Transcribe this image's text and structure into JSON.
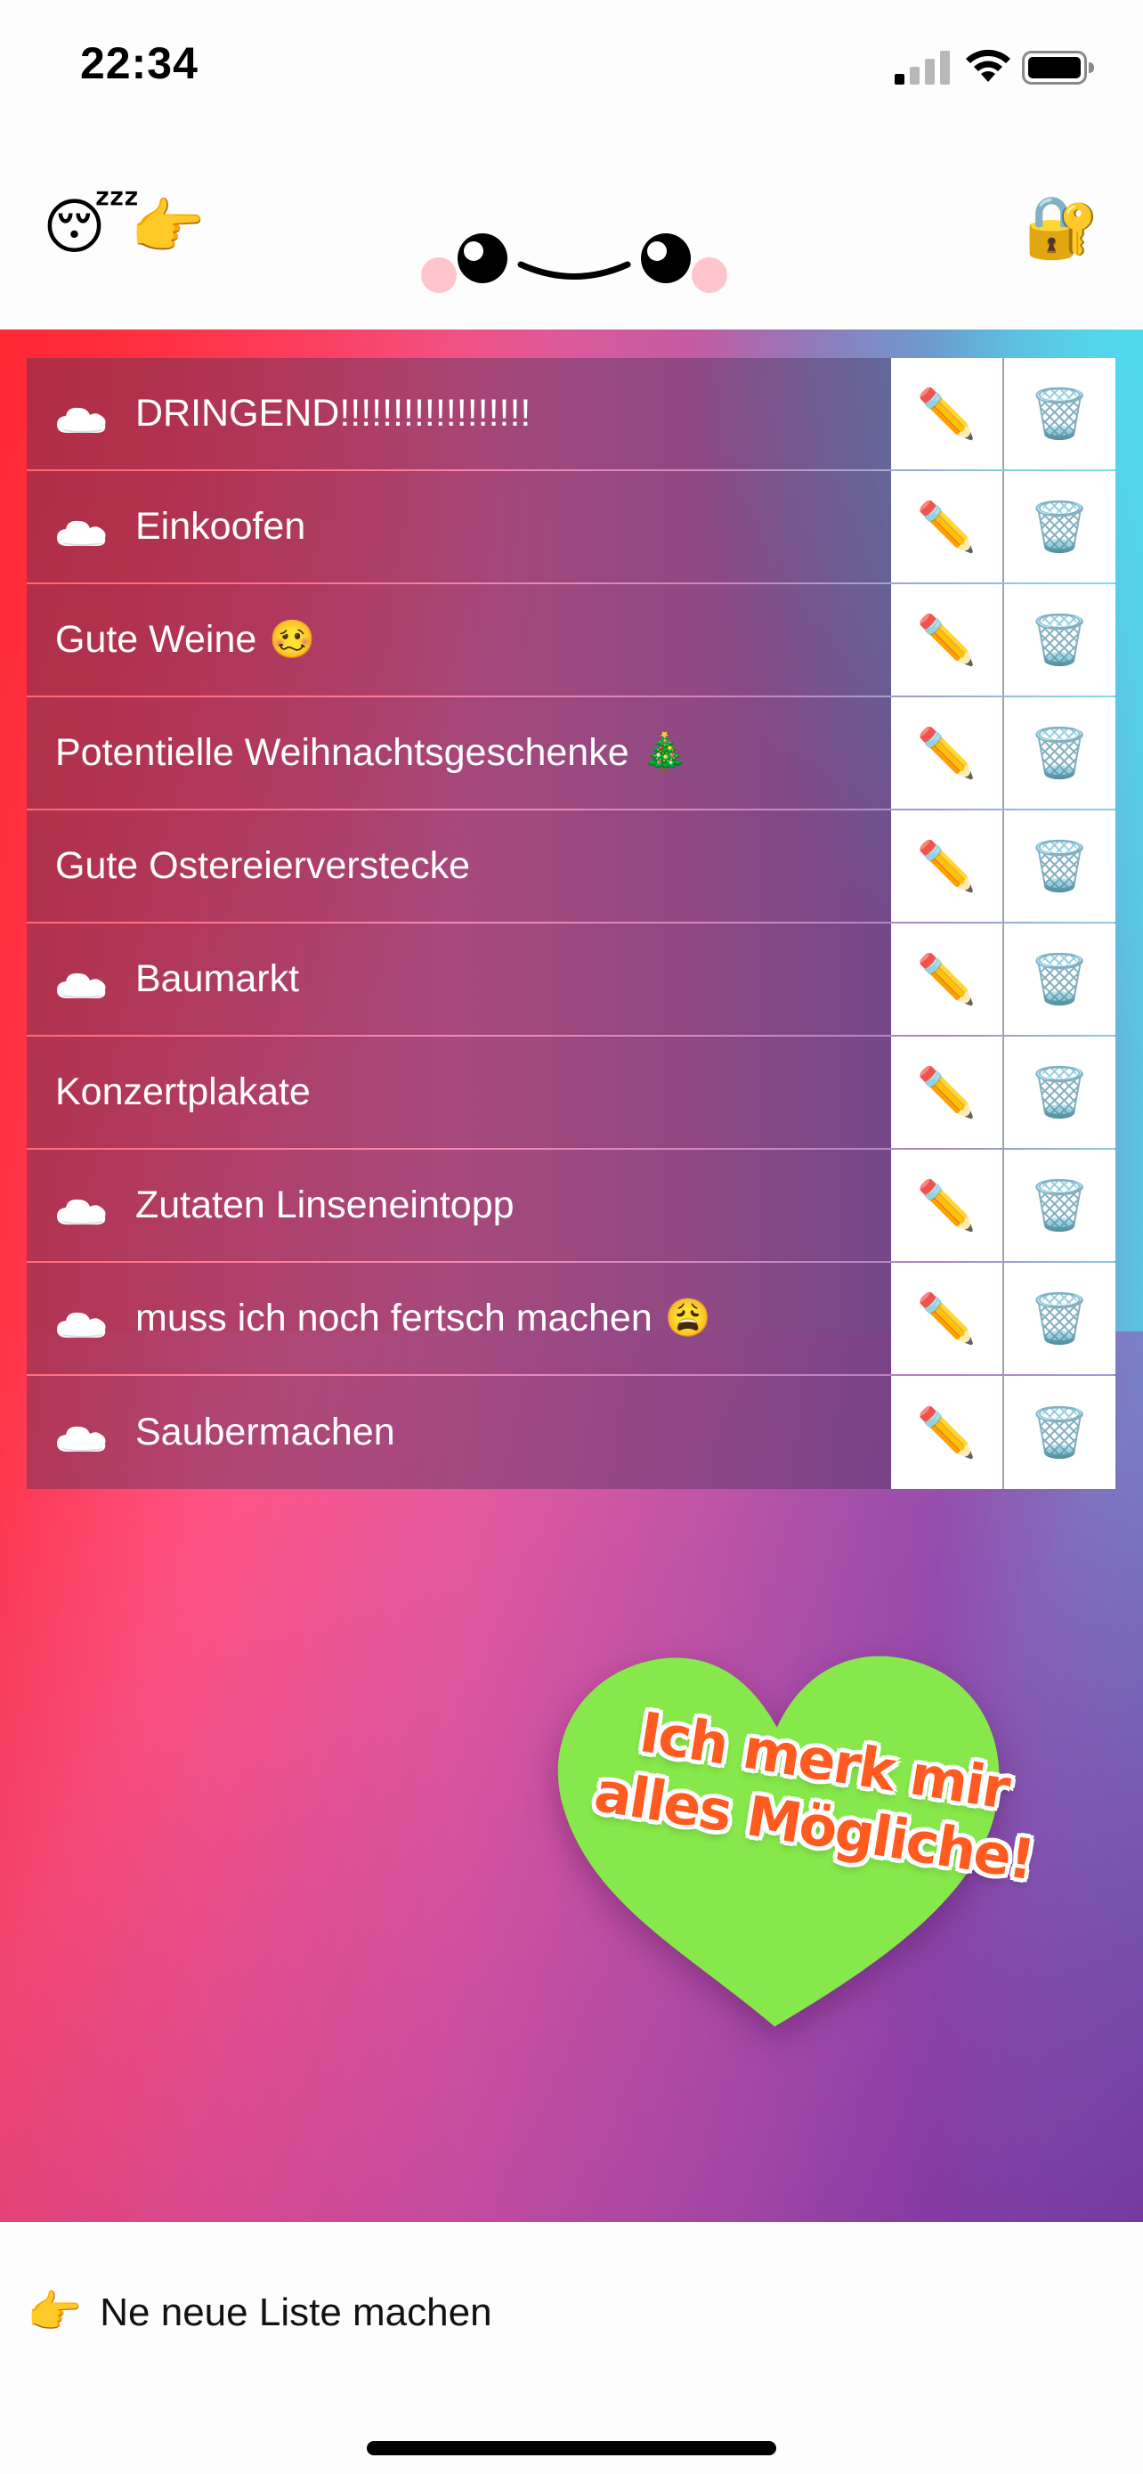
{
  "status_bar": {
    "time": "22:34"
  },
  "header": {
    "left_icons": [
      "😴",
      "👉"
    ],
    "right_icon": "🔐"
  },
  "lists": [
    {
      "label": "DRINGEND!!!!!!!!!!!!!!!!!!",
      "cloud": true,
      "emoji": ""
    },
    {
      "label": "Einkoofen",
      "cloud": true,
      "emoji": ""
    },
    {
      "label": "Gute Weine",
      "cloud": false,
      "emoji": "🥴"
    },
    {
      "label": "Potentielle Weihnachtsgeschenke",
      "cloud": false,
      "emoji": "🎄"
    },
    {
      "label": "Gute Ostereierverstecke",
      "cloud": false,
      "emoji": ""
    },
    {
      "label": "Baumarkt",
      "cloud": true,
      "emoji": ""
    },
    {
      "label": "Konzertplakate",
      "cloud": false,
      "emoji": ""
    },
    {
      "label": "Zutaten Linseneintopp",
      "cloud": true,
      "emoji": ""
    },
    {
      "label": "muss ich noch fertsch machen",
      "cloud": true,
      "emoji": "😩"
    },
    {
      "label": "Saubermachen",
      "cloud": true,
      "emoji": ""
    }
  ],
  "row_actions": {
    "edit_icon": "✏️",
    "delete_icon": "🗑️"
  },
  "sticker": {
    "line1": "Ich merk mir",
    "line2": "alles Mögliche!",
    "heart_color": "#86e84a",
    "text_color": "#ff5a1f"
  },
  "footer": {
    "icon": "👉",
    "label": "Ne neue Liste machen"
  }
}
